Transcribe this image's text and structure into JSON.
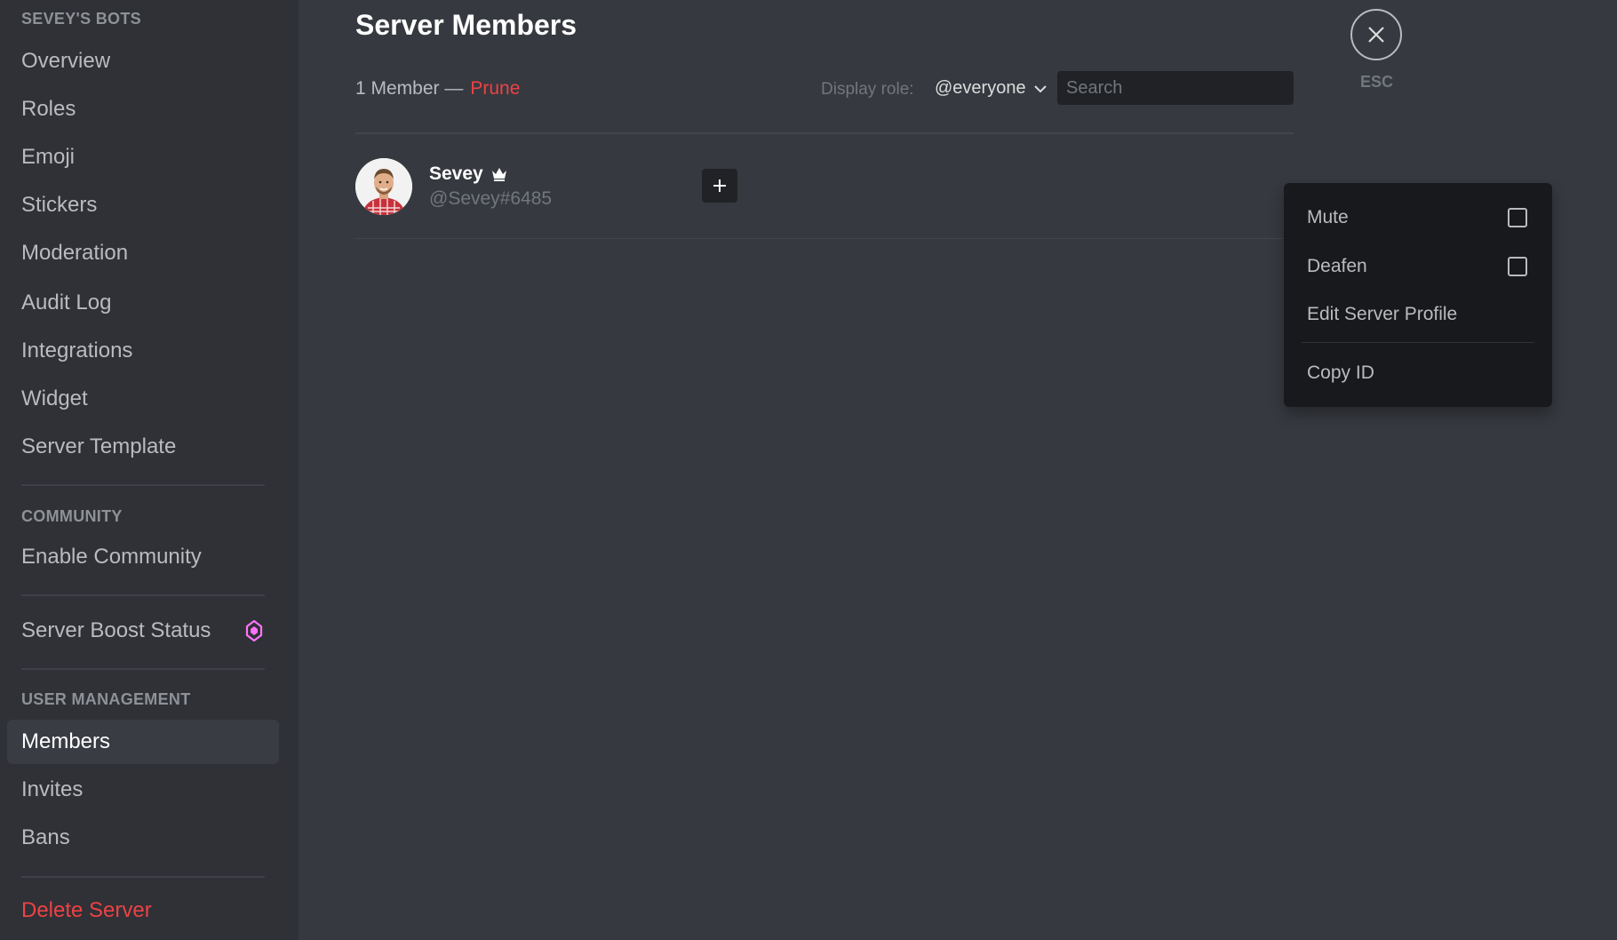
{
  "sidebar": {
    "server_header": "SEVEY'S BOTS",
    "items": [
      {
        "label": "Overview"
      },
      {
        "label": "Roles"
      },
      {
        "label": "Emoji"
      },
      {
        "label": "Stickers"
      },
      {
        "label": "Moderation"
      },
      {
        "label": "Audit Log"
      },
      {
        "label": "Integrations"
      },
      {
        "label": "Widget"
      },
      {
        "label": "Server Template"
      }
    ],
    "community_header": "COMMUNITY",
    "community_items": [
      {
        "label": "Enable Community"
      }
    ],
    "boost_item": {
      "label": "Server Boost Status",
      "icon": "boost-gem-icon",
      "icon_color": "#ff73fa"
    },
    "user_mgmt_header": "USER MANAGEMENT",
    "user_mgmt_items": [
      {
        "label": "Members",
        "active": true
      },
      {
        "label": "Invites"
      },
      {
        "label": "Bans"
      }
    ],
    "delete_label": "Delete Server",
    "danger_color": "#ed4245"
  },
  "main": {
    "title": "Server Members",
    "member_count_text": "1 Member —",
    "prune_label": "Prune",
    "display_role_label": "Display role:",
    "display_role_value": "@everyone",
    "search_placeholder": "Search",
    "members": [
      {
        "name": "Sevey",
        "tag": "@Sevey#6485",
        "is_owner": true,
        "owner_icon": "crown-icon"
      }
    ],
    "add_role_icon": "plus-icon"
  },
  "close": {
    "icon": "close-icon",
    "label": "ESC"
  },
  "context_menu": {
    "items": [
      {
        "label": "Mute",
        "checkbox": true,
        "checked": false
      },
      {
        "label": "Deafen",
        "checkbox": true,
        "checked": false
      },
      {
        "label": "Edit Server Profile"
      },
      {
        "label": "Copy ID"
      }
    ]
  }
}
